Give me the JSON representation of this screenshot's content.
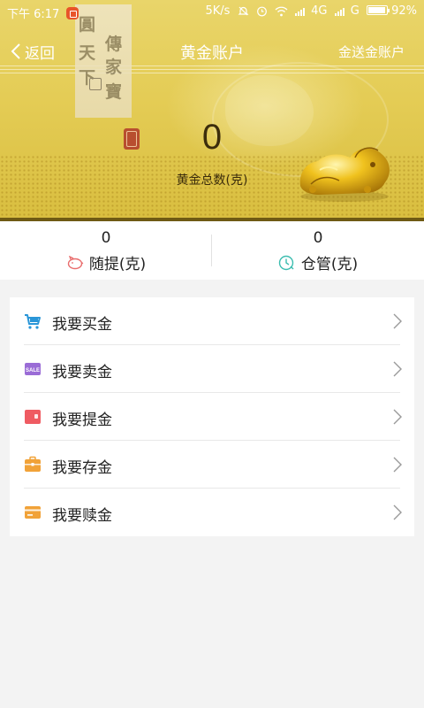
{
  "status_bar": {
    "time": "下午 6:17",
    "net_speed": "5K/s",
    "network": "4G",
    "network2": "G",
    "battery": "92%"
  },
  "nav": {
    "back_label": "返回",
    "title": "黄金账户",
    "right_label": "金送金账户"
  },
  "brand": {
    "chars": [
      "圓",
      "傳",
      "天",
      "家",
      "下",
      "寶"
    ]
  },
  "hero": {
    "total_value": "0",
    "total_label": "黄金总数(克)"
  },
  "stats": [
    {
      "value": "0",
      "label": "随提(克)",
      "icon": "piggy-bank-icon",
      "color": "#e96d6d"
    },
    {
      "value": "0",
      "label": "仓管(克)",
      "icon": "clock-shield-icon",
      "color": "#3cbdb0"
    }
  ],
  "menu": [
    {
      "label": "我要买金",
      "icon": "cart-icon",
      "color": "#2a96d8"
    },
    {
      "label": "我要卖金",
      "icon": "sale-tag-icon",
      "color": "#9a6cd6",
      "icon_text": "SALE"
    },
    {
      "label": "我要提金",
      "icon": "wallet-icon",
      "color": "#ef5b62"
    },
    {
      "label": "我要存金",
      "icon": "briefcase-icon",
      "color": "#f1a238"
    },
    {
      "label": "我要赎金",
      "icon": "card-coin-icon",
      "color": "#f1a238"
    }
  ]
}
